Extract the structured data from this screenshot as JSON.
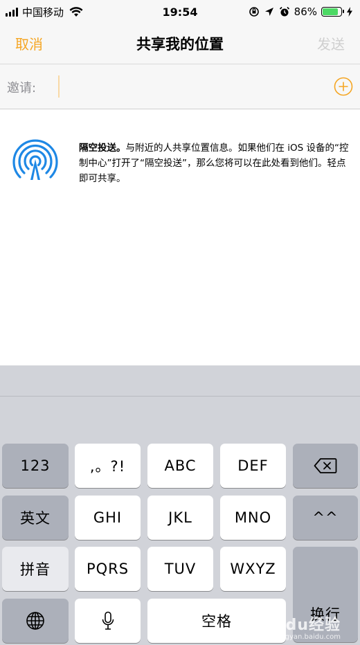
{
  "status_bar": {
    "carrier": "中国移动",
    "time": "19:54",
    "battery_percent": "86%",
    "battery_level": 0.86,
    "icons": [
      "signal-icon",
      "wifi-icon",
      "orientation-lock-icon",
      "location-icon",
      "alarm-icon",
      "battery-icon",
      "charging-icon"
    ]
  },
  "nav": {
    "cancel": "取消",
    "title": "共享我的位置",
    "send": "发送",
    "accent_color": "#f5a623",
    "disabled_color": "#cfcfcf"
  },
  "invite": {
    "label": "邀请:",
    "value": "",
    "placeholder": "",
    "add_icon": "plus-circle-icon"
  },
  "airdrop": {
    "icon": "airdrop-icon",
    "icon_color": "#1e88e5",
    "title": "隔空投送。",
    "body": "与附近的人共享位置信息。如果他们在 iOS 设备的“控制中心”打开了“隔空投送”，那么您将可以在此处看到他们。轻点即可共享。"
  },
  "keyboard": {
    "row1": {
      "numbers": "123",
      "punct": ",。?!",
      "abc": "ABC",
      "def": "DEF",
      "delete_icon": "backspace-icon"
    },
    "row2": {
      "english": "英文",
      "ghi": "GHI",
      "jkl": "JKL",
      "mno": "MNO",
      "emoji": "^^"
    },
    "row3": {
      "pinyin": "拼音",
      "pqrs": "PQRS",
      "tuv": "TUV",
      "wxyz": "WXYZ"
    },
    "row4": {
      "globe_icon": "globe-icon",
      "mic_icon": "microphone-icon",
      "space": "空格"
    },
    "return": "换行"
  },
  "watermark": {
    "logo": "Baidu经验",
    "url": "jingyan.baidu.com"
  }
}
